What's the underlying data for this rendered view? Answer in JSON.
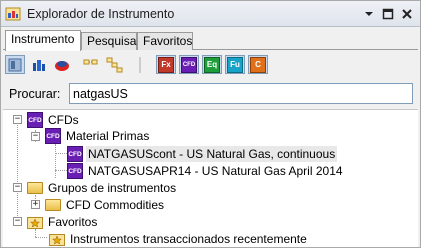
{
  "window": {
    "title": "Explorador de Instrumento"
  },
  "tabs": [
    {
      "label": "Instrumento",
      "active": true
    },
    {
      "label": "Pesquisar",
      "active": false
    },
    {
      "label": "Favoritos",
      "active": false
    }
  ],
  "toolbar": {
    "icons": [
      "layout-icon",
      "chart-bars-icon",
      "alert-icon",
      "tree-collapse-icon",
      "tree-expand-icon",
      "forex-filter-icon",
      "cfd-filter-icon",
      "equity-filter-icon",
      "futures-filter-icon",
      "commodity-filter-icon"
    ],
    "fx_text": "Fx",
    "cfd_text": "CFD",
    "eq_text": "Eq",
    "fu_text": "Fu",
    "co_text": "C"
  },
  "search": {
    "label": "Procurar:",
    "value": "natgasUS"
  },
  "tree": {
    "cfds": "CFDs",
    "material_primas": "Material Primas",
    "item1": "NATGASUScont - US Natural Gas, continuous",
    "item2": "NATGASUSAPR14 - US Natural Gas April 2014",
    "grupos": "Grupos de instrumentos",
    "cfd_commodities": "CFD Commodities",
    "favoritos": "Favoritos",
    "recent": "Instrumentos transaccionados recentemente",
    "cfd_icon_text": "CFD"
  },
  "colors": {
    "cfd_purple": "#6a1fb4",
    "selection_blue": "#c8d9f0"
  }
}
